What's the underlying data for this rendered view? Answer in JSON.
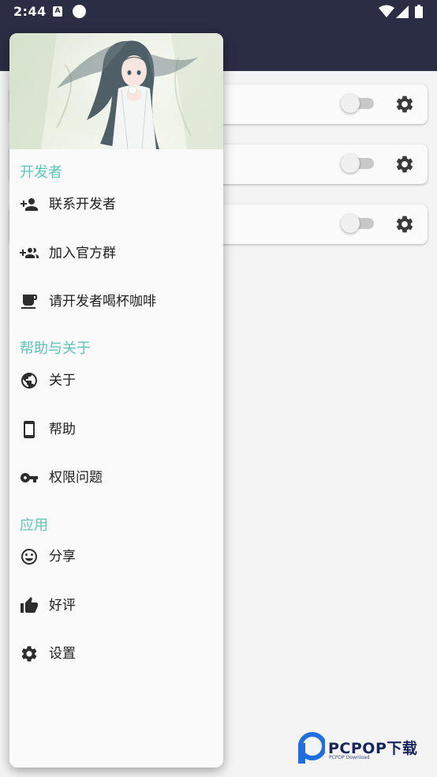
{
  "status_bar": {
    "time": "2:44",
    "a_badge": "A"
  },
  "colors": {
    "header_bg": "#2b2d45",
    "section_title": "#5cc5b9",
    "drawer_bg": "#fafafa"
  },
  "cards": [
    {
      "toggle": "off",
      "icon": "gear-icon"
    },
    {
      "toggle": "off",
      "icon": "gear-icon"
    },
    {
      "toggle": "off",
      "icon": "gear-icon"
    }
  ],
  "drawer": {
    "header_image": "anime-girl-illustration",
    "sections": [
      {
        "title": "开发者",
        "items": [
          {
            "label": "联系开发者",
            "icon": "person-add-icon"
          },
          {
            "label": "加入官方群",
            "icon": "group-add-icon"
          },
          {
            "label": "请开发者喝杯咖啡",
            "icon": "coffee-icon"
          }
        ]
      },
      {
        "title": "帮助与关于",
        "items": [
          {
            "label": "关于",
            "icon": "globe-icon"
          },
          {
            "label": "帮助",
            "icon": "phone-icon"
          },
          {
            "label": "权限问题",
            "icon": "key-icon"
          }
        ]
      },
      {
        "title": "应用",
        "items": [
          {
            "label": "分享",
            "icon": "smiley-icon"
          },
          {
            "label": "好评",
            "icon": "thumb-up-icon"
          },
          {
            "label": "设置",
            "icon": "settings-icon"
          }
        ]
      }
    ]
  },
  "watermark": {
    "brand": "PCPOP下载",
    "sub": "PCPOP Download"
  }
}
